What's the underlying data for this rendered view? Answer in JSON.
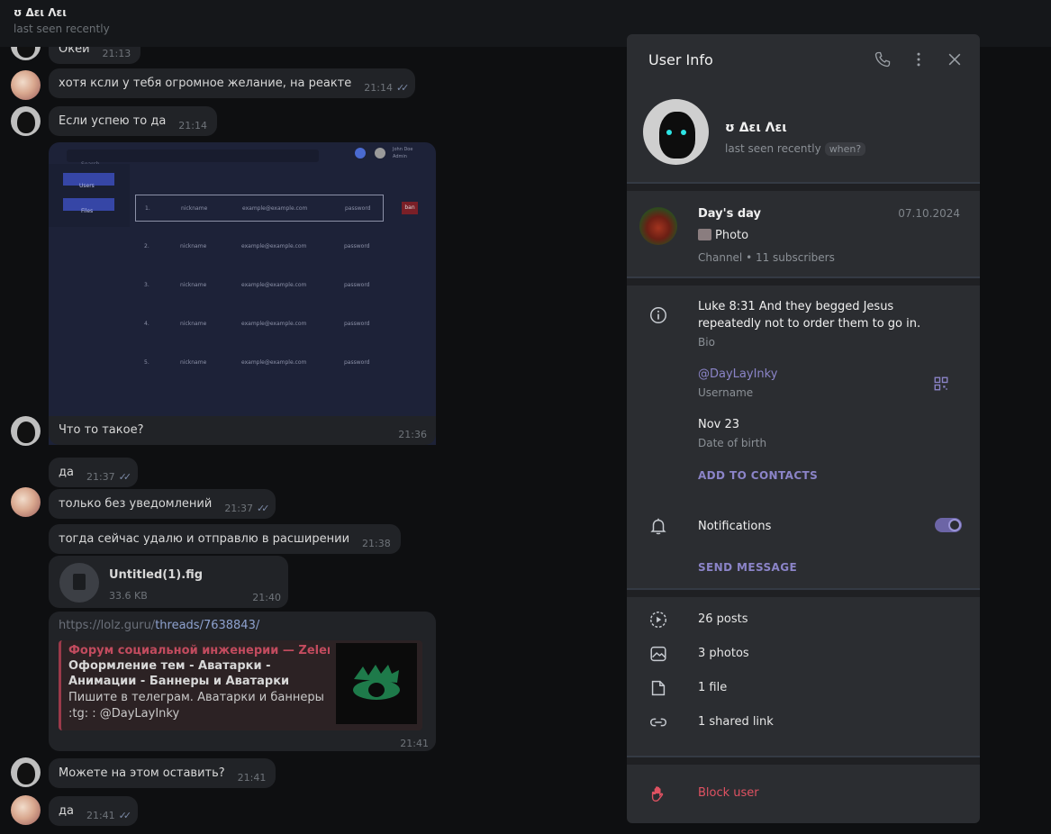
{
  "chat_header": {
    "name": "ʊ Δει Λει",
    "status": "last seen recently"
  },
  "messages": [
    {
      "text": "Окей",
      "time": "21:13"
    },
    {
      "text": "хотя ксли у тебя огромное желание, на реакте",
      "time": "21:14"
    },
    {
      "text": "Если успею то да",
      "time": "21:14"
    },
    {
      "text": "Что то такое?",
      "time": "21:36"
    },
    {
      "text": "да",
      "time": "21:37"
    },
    {
      "text": "только без уведомлений",
      "time": "21:37"
    },
    {
      "text": "тогда сейчас удалю и отправлю в расширении",
      "time": "21:38"
    },
    {
      "text": "Можете на этом оставить?",
      "time": "21:41"
    },
    {
      "text": "да",
      "time": "21:41"
    }
  ],
  "screenshot_mock": {
    "search": "Search",
    "user_name": "John Doe",
    "user_role": "Admin",
    "sidebar": [
      "Users",
      "Files"
    ],
    "rows": [
      {
        "num": "1.",
        "nick": "nickname",
        "email": "example@example.com",
        "pass": "password"
      },
      {
        "num": "2.",
        "nick": "nickname",
        "email": "example@example.com",
        "pass": "password"
      },
      {
        "num": "3.",
        "nick": "nickname",
        "email": "example@example.com",
        "pass": "password"
      },
      {
        "num": "4.",
        "nick": "nickname",
        "email": "example@example.com",
        "pass": "password"
      },
      {
        "num": "5.",
        "nick": "nickname",
        "email": "example@example.com",
        "pass": "password"
      }
    ],
    "ban": "ban"
  },
  "file": {
    "name": "Untitled(1).fig",
    "size": "33.6 KB",
    "time": "21:40"
  },
  "link": {
    "url_prefix": "https://lolz.guru/",
    "url_path": "threads/7638843/",
    "site": "Форум социальной инженерии — Zelenka....",
    "title": "Оформление тем - Аватарки - Анимации - Баннеры и Аватарки",
    "desc_line1": "Пишите в телеграм. Аватарки и баннеры",
    "desc_line2": ":tg: : @DayLayInky",
    "time": "21:41"
  },
  "panel": {
    "title": "User Info",
    "name": "ʊ Δει Λει",
    "status": "last seen recently",
    "when": "when?",
    "channel": {
      "name": "Day's day",
      "date": "07.10.2024",
      "post": "Photo",
      "meta": "Channel • 11 subscribers"
    },
    "bio": "Luke 8:31 And they begged Jesus repeatedly not to order them to go in.",
    "bio_label": "Bio",
    "username": "@DayLayInky",
    "username_label": "Username",
    "birth": "Nov 23",
    "birth_label": "Date of birth",
    "add_contacts": "ADD TO CONTACTS",
    "notifications": "Notifications",
    "notifications_on": true,
    "send_message": "SEND MESSAGE",
    "media": [
      "26 posts",
      "3 photos",
      "1 file",
      "1 shared link"
    ],
    "block": "Block user"
  }
}
